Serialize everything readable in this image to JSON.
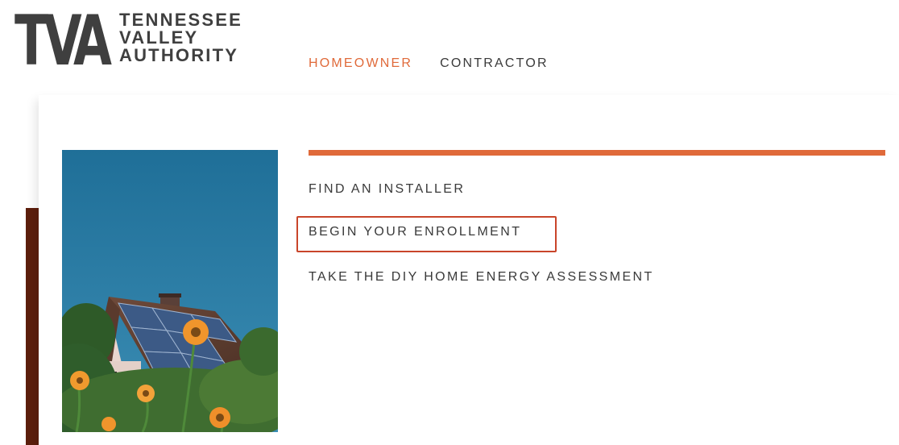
{
  "logo": {
    "mark": "TVA",
    "name_lines": [
      "TENNESSEE",
      "VALLEY",
      "AUTHORITY"
    ]
  },
  "nav": {
    "items": [
      {
        "label": "HOMEOWNER",
        "active": true
      },
      {
        "label": "CONTRACTOR",
        "active": false
      }
    ]
  },
  "submenu": {
    "items": [
      {
        "label": "FIND AN INSTALLER"
      },
      {
        "label": "BEGIN YOUR ENROLLMENT",
        "highlighted": true
      },
      {
        "label": "TAKE THE DIY HOME ENERGY ASSESSMENT"
      }
    ]
  },
  "photo": {
    "subject": "house with rooftop solar panels and orange flowers"
  },
  "colors": {
    "accent": "#e06a3a",
    "logo_gray": "#3f3f3f",
    "text": "#3a3a3a",
    "brown_strip": "#5c1e0c",
    "highlight_box": "#c9452a",
    "sky": "#2a7aa1"
  }
}
